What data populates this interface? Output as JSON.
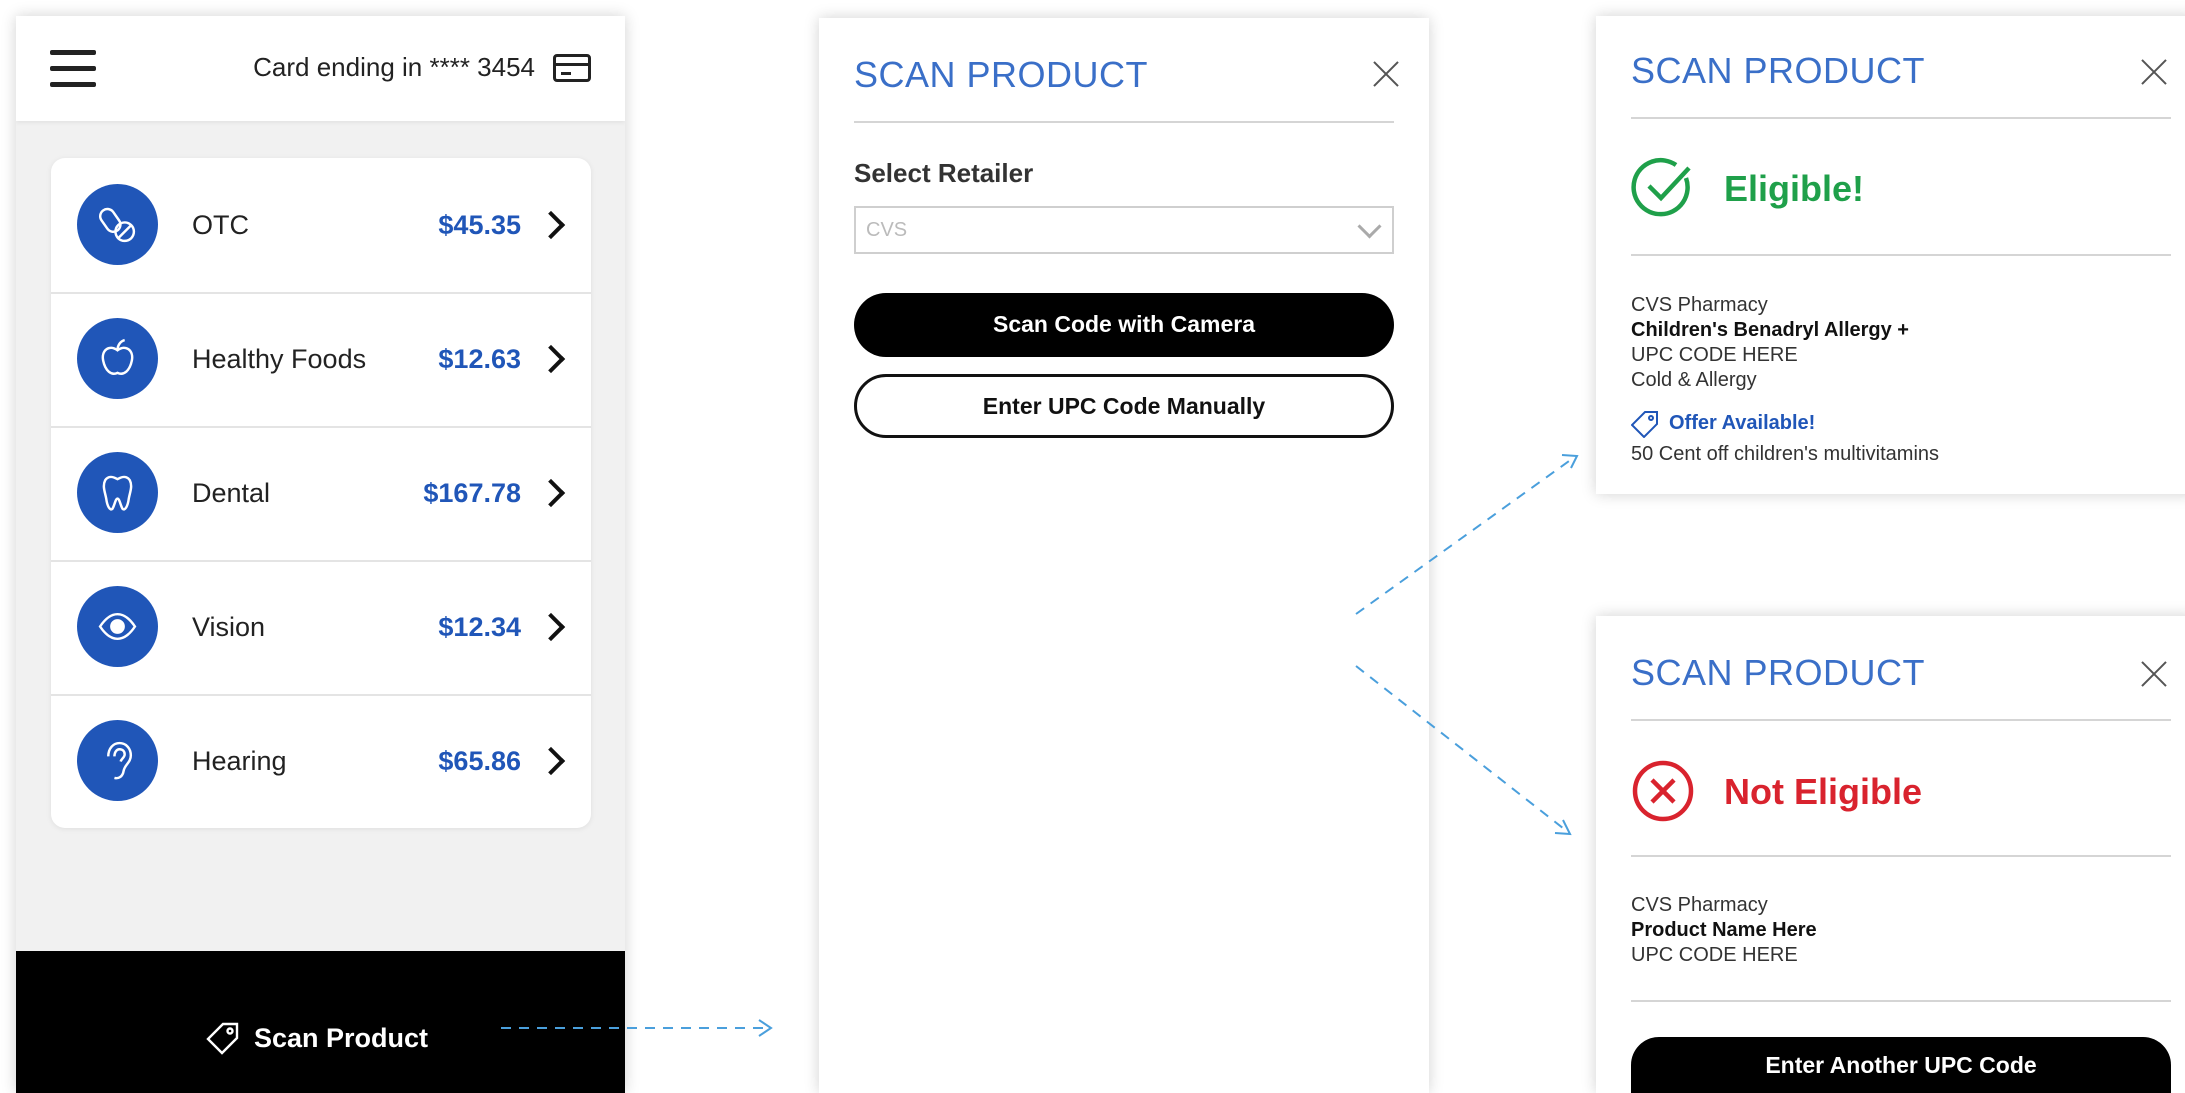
{
  "colors": {
    "accent": "#2056b8",
    "title_blue": "#3a6fc8",
    "eligible_green": "#1fa04a",
    "not_eligible_red": "#d9232e",
    "arrow_blue": "#4a9fdc"
  },
  "phone": {
    "header": {
      "card_text": "Card ending in **** 3454",
      "menu_icon": "hamburger-menu-icon",
      "card_icon": "credit-card-icon"
    },
    "benefits": [
      {
        "label": "OTC",
        "amount": "$45.35",
        "icon": "pills-icon"
      },
      {
        "label": "Healthy Foods",
        "amount": "$12.63",
        "icon": "apple-icon"
      },
      {
        "label": "Dental",
        "amount": "$167.78",
        "icon": "tooth-icon"
      },
      {
        "label": "Vision",
        "amount": "$12.34",
        "icon": "eye-icon"
      },
      {
        "label": "Hearing",
        "amount": "$65.86",
        "icon": "ear-icon"
      }
    ],
    "scan_button": {
      "label": "Scan Product",
      "icon": "tag-icon"
    }
  },
  "scan_modal": {
    "title": "SCAN PRODUCT",
    "retailer_label": "Select Retailer",
    "retailer_value": "CVS",
    "camera_button": "Scan Code with Camera",
    "manual_button": "Enter UPC Code Manually"
  },
  "eligible_modal": {
    "title": "SCAN PRODUCT",
    "status": "Eligible!",
    "store": "CVS Pharmacy",
    "product": "Children's Benadryl Allergy +",
    "upc": "UPC CODE HERE",
    "category": "Cold & Allergy",
    "offer_label": "Offer Available!",
    "offer_detail": "50 Cent off children's multivitamins"
  },
  "not_eligible_modal": {
    "title": "SCAN PRODUCT",
    "status": "Not Eligible",
    "store": "CVS Pharmacy",
    "product": "Product Name Here",
    "upc": "UPC CODE HERE",
    "action_button": "Enter Another UPC Code"
  }
}
